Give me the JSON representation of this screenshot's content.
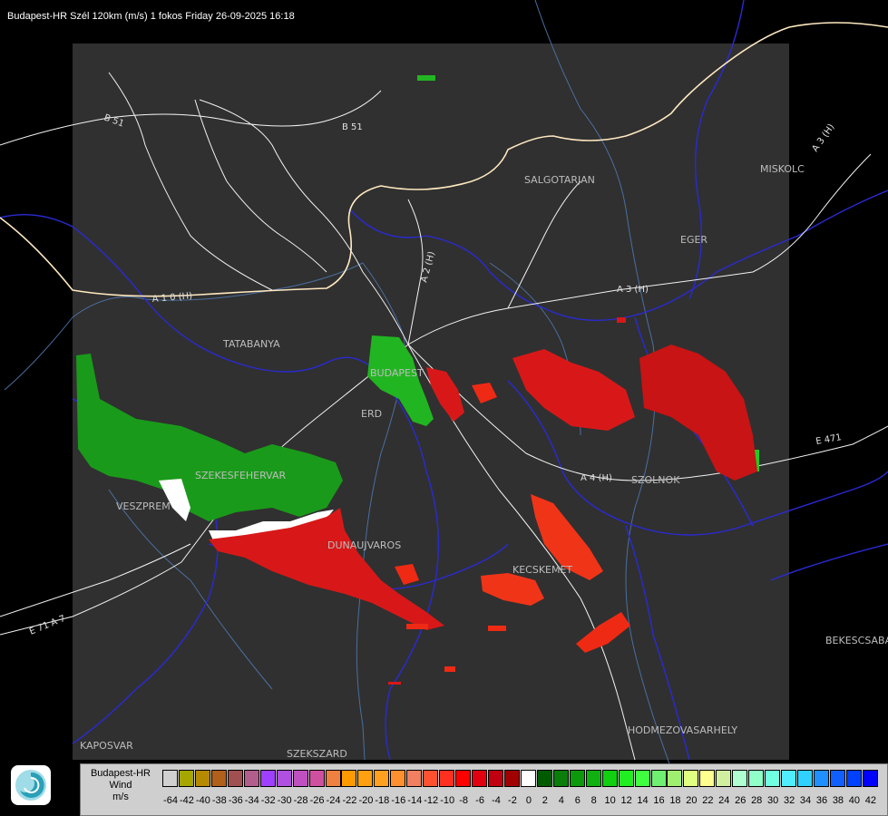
{
  "title": "Budapest-HR Szél 120km (m/s) 1 fokos Friday 26-09-2025 16:18",
  "colors": {
    "background": "#000000",
    "radar_area": "#303030",
    "county_border": "#2a2ad4",
    "river": "#4a6fa0",
    "road": "#f2f2f2",
    "country_border": "#ffe9c0",
    "approaching": "#1aa01a",
    "receding": "#d81818"
  },
  "places": [
    {
      "name": "SALGOTARJAN"
    },
    {
      "name": "MISKOLC"
    },
    {
      "name": "EGER"
    },
    {
      "name": "TATABANYA"
    },
    {
      "name": "BUDAPEST"
    },
    {
      "name": "ERD"
    },
    {
      "name": "SZEKESFEHERVAR"
    },
    {
      "name": "VESZPREM"
    },
    {
      "name": "DUNAUJVAROS"
    },
    {
      "name": "KECSKEMET"
    },
    {
      "name": "SZOLNOK"
    },
    {
      "name": "BEKESCSABA"
    },
    {
      "name": "HODMEZOVASARHELY"
    },
    {
      "name": "KAPOSVAR"
    },
    {
      "name": "SZEKSZARD"
    }
  ],
  "roads": [
    {
      "label": "B 51"
    },
    {
      "label": "B 51"
    },
    {
      "label": "A 3 (H)"
    },
    {
      "label": "A 3 (H)"
    },
    {
      "label": "A 4 (H)"
    },
    {
      "label": "E 471"
    },
    {
      "label": "A 1 0 (H)"
    },
    {
      "label": "A 2 (H)"
    },
    {
      "label": "E 71 A 7"
    }
  ],
  "legend": {
    "line1": "Budapest-HR",
    "line2": "Wind",
    "line3": "m/s",
    "ticks": [
      "-64",
      "-42",
      "-40",
      "-38",
      "-36",
      "-34",
      "-32",
      "-30",
      "-28",
      "-26",
      "-24",
      "-22",
      "-20",
      "-18",
      "-16",
      "-14",
      "-12",
      "-10",
      "-8",
      "-6",
      "-4",
      "-2",
      "0",
      "2",
      "4",
      "6",
      "8",
      "10",
      "12",
      "14",
      "16",
      "18",
      "20",
      "22",
      "24",
      "26",
      "28",
      "30",
      "32",
      "34",
      "36",
      "38",
      "40",
      "42"
    ],
    "swatch_colors": [
      "#d0d0d0",
      "#a6a600",
      "#b58a00",
      "#b0601a",
      "#a05050",
      "#b25e8c",
      "#a040ff",
      "#b050e0",
      "#c050c0",
      "#d050a0",
      "#ee8040",
      "#ff9a00",
      "#ffa010",
      "#ffa020",
      "#ff9030",
      "#f08060",
      "#ff5030",
      "#ff3020",
      "#ff0000",
      "#e00010",
      "#c00010",
      "#a00000",
      "#ffffff",
      "#005a00",
      "#0a7d0a",
      "#0c9a0c",
      "#10b010",
      "#10d010",
      "#20ee20",
      "#40ff40",
      "#70f070",
      "#a0f070",
      "#e0ff80",
      "#ffff90",
      "#d0f0a0",
      "#b0ffd0",
      "#90ffc8",
      "#70ffe0",
      "#50ecff",
      "#30d0ff",
      "#2090ff",
      "#1060ff",
      "#0040ff",
      "#0000ff"
    ]
  },
  "logo": {
    "icon": "weather-service-logo-icon"
  }
}
